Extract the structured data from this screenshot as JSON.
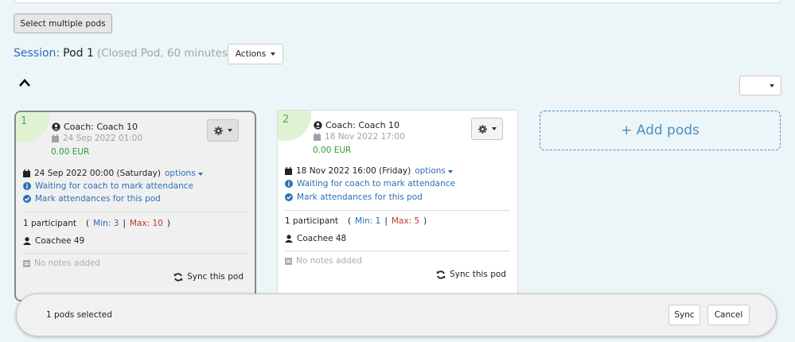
{
  "toolbar": {
    "select_multiple_label": "Select multiple pods"
  },
  "session": {
    "label": "Session:",
    "name": "Pod 1",
    "meta": "(Closed Pod, 60 minutes)",
    "actions_label": "Actions"
  },
  "pods": [
    {
      "number": "1",
      "selected": true,
      "coach": "Coach: Coach 10",
      "coach_date": "24 Sep 2022 01:00",
      "price": "0.00 EUR",
      "schedule": "24 Sep 2022 00:00 (Saturday)",
      "options_label": "options",
      "waiting_text": "Waiting for coach to mark attendance",
      "mark_text": "Mark attendances for this pod",
      "participants": "1 participant",
      "min_label": "Min: 3",
      "max_label": "Max: 10",
      "coachee": "Coachee 49",
      "notes": "No notes added",
      "sync_label": "Sync this pod"
    },
    {
      "number": "2",
      "selected": false,
      "coach": "Coach: Coach 10",
      "coach_date": "18 Nov 2022 17:00",
      "price": "0.00 EUR",
      "schedule": "18 Nov 2022 16:00 (Friday)",
      "options_label": "options",
      "waiting_text": "Waiting for coach to mark attendance",
      "mark_text": "Mark attendances for this pod",
      "participants": "1 participant",
      "min_label": "Min: 1",
      "max_label": "Max: 5",
      "coachee": "Coachee 48",
      "notes": "No notes added",
      "sync_label": "Sync this pod"
    }
  ],
  "add_pods_label": "+ Add pods",
  "selection_bar": {
    "text": "1 pods selected",
    "sync_label": "Sync",
    "cancel_label": "Cancel"
  },
  "colors": {
    "link": "#2d6fb5",
    "price": "#2a9d3a",
    "max": "#c0392b",
    "pod_badge": "#dff3d3",
    "add_pods": "#4a90c4"
  },
  "icons": [
    "chevron-up-icon",
    "caret-down-icon",
    "user-circle-icon",
    "calendar-icon",
    "gear-icon",
    "info-icon",
    "check-circle-icon",
    "user-icon",
    "note-icon",
    "sync-icon"
  ]
}
